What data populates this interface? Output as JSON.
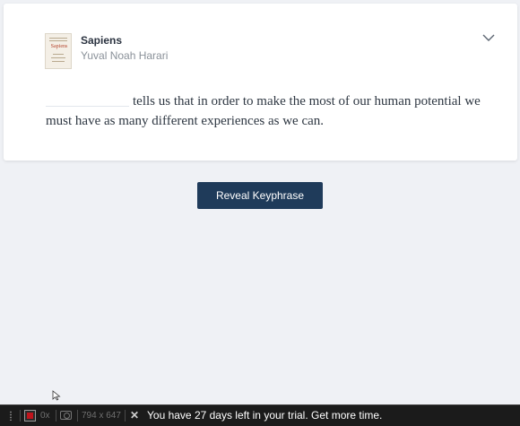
{
  "book": {
    "title": "Sapiens",
    "author": "Yuval Noah Harari",
    "cover_word": "Sapiens"
  },
  "quote": {
    "text_line": "tells us that in order to make the most of our human potential we must have as many different experiences as we can."
  },
  "actions": {
    "reveal_label": "Reveal Keyphrase"
  },
  "taskbar": {
    "zoom": "0x",
    "dimensions": "794 x 647",
    "trial_text": "You have 27 days left in your trial.",
    "more_time": "Get more time."
  },
  "colors": {
    "page_bg": "#eff1f5",
    "button_bg": "#1f3b5a",
    "taskbar_bg": "#1b1b1b",
    "record_red": "#c0141c"
  }
}
